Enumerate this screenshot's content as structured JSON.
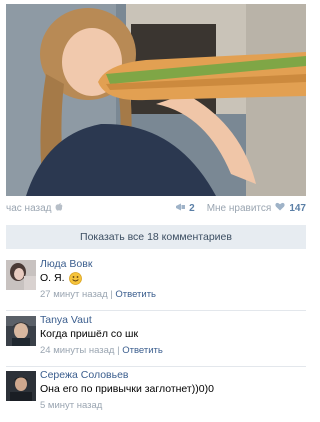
{
  "post": {
    "time": "час назад",
    "share_count": "2",
    "like_label": "Мне нравится",
    "like_count": "147"
  },
  "show_all_comments": "Показать все 18 комментариев",
  "comments": [
    {
      "author": "Люда Вовк",
      "text": "О. Я.",
      "emoji": "smiling-face-emoji",
      "time": "27 минут назад",
      "separator": "|",
      "reply": "Ответить"
    },
    {
      "author": "Tanya Vaut",
      "text": "Когда пришёл со шк",
      "time": "24 минуты назад",
      "separator": "|",
      "reply": "Ответить"
    },
    {
      "author": "Сережа Соловьев",
      "text": "Она его по привычки заглотнет))0)0",
      "time": "5 минут назад"
    }
  ],
  "colors": {
    "link": "#3b5e8e",
    "muted": "#9aa5b1",
    "button_bg": "#e7ecf1"
  },
  "icons": [
    "apple-icon",
    "megaphone-icon",
    "heart-icon",
    "smiling-face-emoji"
  ]
}
